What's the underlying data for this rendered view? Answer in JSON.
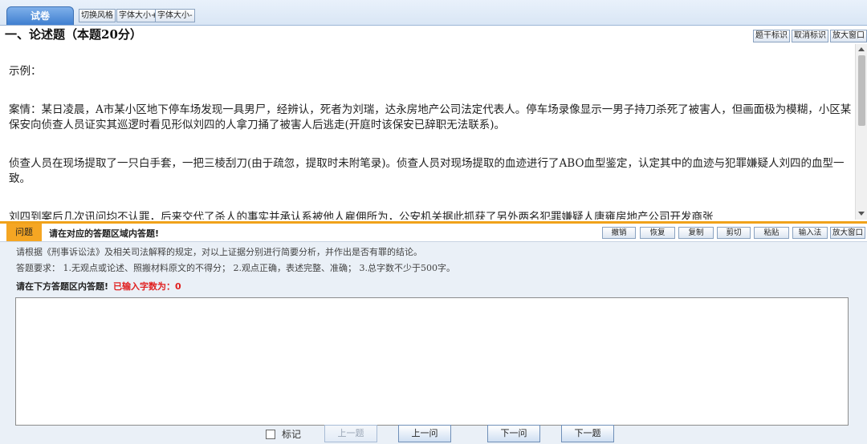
{
  "toolbar": {
    "tab_label": "试卷",
    "switch_style": "切换风格",
    "font_bigger": "字体大小+",
    "font_smaller": "字体大小-"
  },
  "question": {
    "title": "一、论述题（本题20分）",
    "buttons": {
      "mark": "题干标识",
      "unmark": "取消标识",
      "enlarge": "放大窗口"
    },
    "paragraphs": [
      "示例：",
      "案情：某日凌晨，A市某小区地下停车场发现一具男尸，经辨认，死者为刘瑞，达永房地产公司法定代表人。停车场录像显示一男子持刀杀死了被害人，但画面极为模糊，小区某保安向侦查人员证实其巡逻时看见形似刘四的人拿刀捅了被害人后逃走(开庭时该保安已辞职无法联系)。",
      "侦查人员在现场提取了一只白手套，一把三棱刮刀(由于疏忽，提取时未附笔录)。侦查人员对现场提取的血迹进行了ABO血型鉴定，认定其中的血迹与犯罪嫌疑人刘四的血型一致。",
      "刘四到案后几次讯问均不认罪，后来交代了杀人的事实并承认系被他人雇佣所为，公安机关据此抓获了另外两名犯罪嫌疑人唐雍房地产公司开发商张"
    ]
  },
  "answer": {
    "tag": "问题",
    "note": "请在对应的答题区域内答题!",
    "buttons": {
      "undo": "撤销",
      "redo": "恢复",
      "copy": "复制",
      "cut": "剪切",
      "paste": "粘贴",
      "ime": "输入法",
      "enlarge": "放大窗口"
    },
    "requirement_1": "请根据《刑事诉讼法》及相关司法解释的规定，对以上证据分别进行简要分析，并作出是否有罪的结论。",
    "requirement_2": "答题要求： 1.无观点或论述、照搬材料原文的不得分； 2.观点正确，表述完整、准确； 3.总字数不少于500字。",
    "prompt": "请在下方答题区内答题!",
    "count_label": "已输入字数为：0",
    "text_value": ""
  },
  "nav": {
    "mark": "标记",
    "prev_question": "上一题",
    "prev_ask": "上一问",
    "next_ask": "下一问",
    "next_question": "下一题"
  }
}
